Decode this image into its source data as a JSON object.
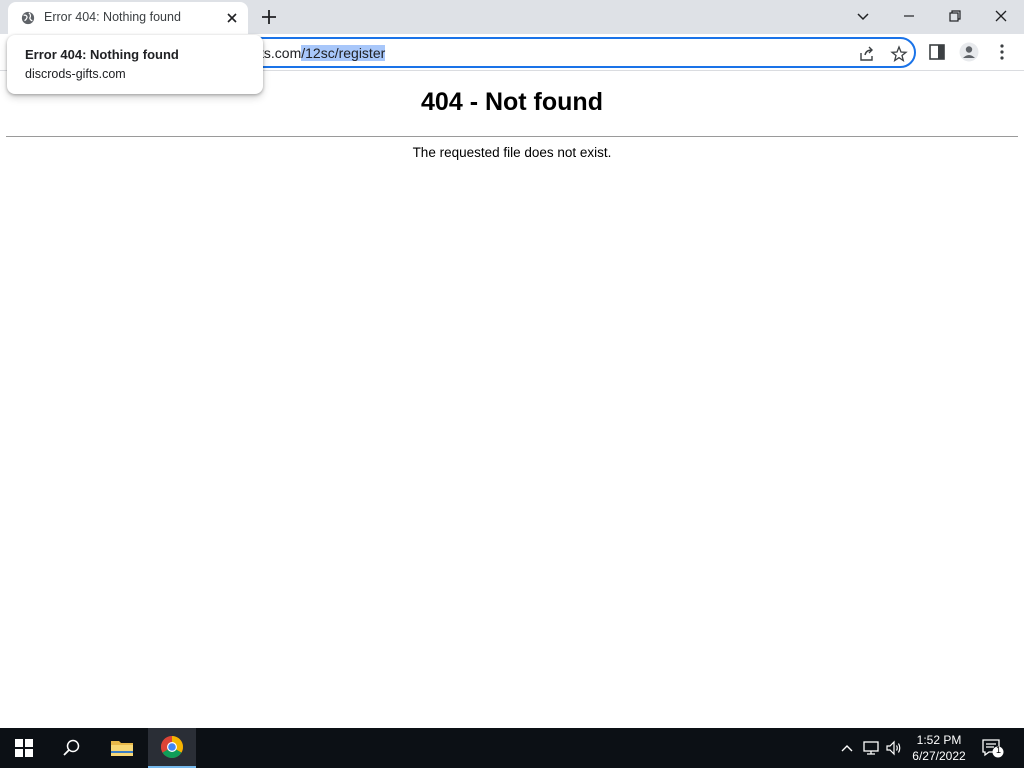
{
  "browser": {
    "tab": {
      "title": "Error 404: Nothing found",
      "favicon": "globe-icon"
    },
    "hover_card": {
      "title": "Error 404: Nothing found",
      "domain": "discrods-gifts.com"
    },
    "omnibox": {
      "url_visible": "ts.com",
      "url_selected": "/12sc/register"
    }
  },
  "page": {
    "heading": "404 - Not found",
    "message": "The requested file does not exist."
  },
  "taskbar": {
    "time": "1:52 PM",
    "date": "6/27/2022",
    "notification_count": "1"
  },
  "colors": {
    "tabstrip_bg": "#dee1e6",
    "omnibox_focus": "#1a73e8",
    "selection": "#a8c7fa",
    "taskbar_bg": "#0c1015"
  }
}
